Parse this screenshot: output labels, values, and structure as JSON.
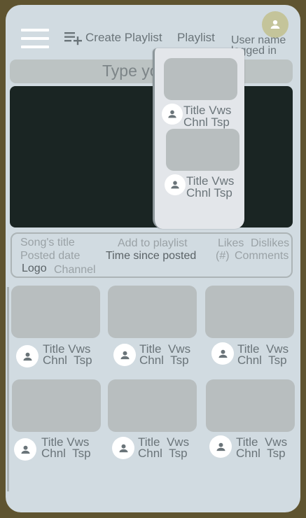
{
  "header": {
    "create_playlist_label": "Create Playlist",
    "playlist_label": "Playlist",
    "user_name": "User name",
    "logged_in": "logged in"
  },
  "search": {
    "placeholder": "Type your search"
  },
  "dropdown": {
    "items": [
      {
        "title": "Title",
        "views": "Vws",
        "channel": "Chnl",
        "timestamp": "Tsp"
      },
      {
        "title": "Title",
        "views": "Vws",
        "channel": "Chnl",
        "timestamp": "Tsp"
      }
    ]
  },
  "info": {
    "song_title": "Song's title",
    "posted_date": "Posted date",
    "logo": "Logo",
    "channel": "Channel",
    "add_to_playlist": "Add to playlist",
    "time_since_posted": "Time since posted",
    "likes": "Likes",
    "dislikes": "Dislikes",
    "count": "(#)",
    "comments": "Comments"
  },
  "videos": [
    {
      "title": "Title",
      "views": "Vws",
      "channel": "Chnl",
      "timestamp": "Tsp"
    },
    {
      "title": "Title",
      "views": "Vws",
      "channel": "Chnl",
      "timestamp": "Tsp"
    },
    {
      "title": "Title",
      "views": "Vws",
      "channel": "Chnl",
      "timestamp": "Tsp"
    },
    {
      "title": "Title",
      "views": "Vws",
      "channel": "Chnl",
      "timestamp": "Tsp"
    },
    {
      "title": "Title",
      "views": "Vws",
      "channel": "Chnl",
      "timestamp": "Tsp"
    },
    {
      "title": "Title",
      "views": "Vws",
      "channel": "Chnl",
      "timestamp": "Tsp"
    }
  ],
  "icons": {
    "menu": "hamburger-menu-icon",
    "create_playlist": "playlist-add-icon",
    "avatar": "person-icon"
  },
  "colors": {
    "frame": "#5f5430",
    "screen": "#d1dbe1",
    "video_player": "#1a2523",
    "placeholder": "#b8bebf",
    "text": "#6a7479",
    "avatar_top": "#c4c49a"
  }
}
